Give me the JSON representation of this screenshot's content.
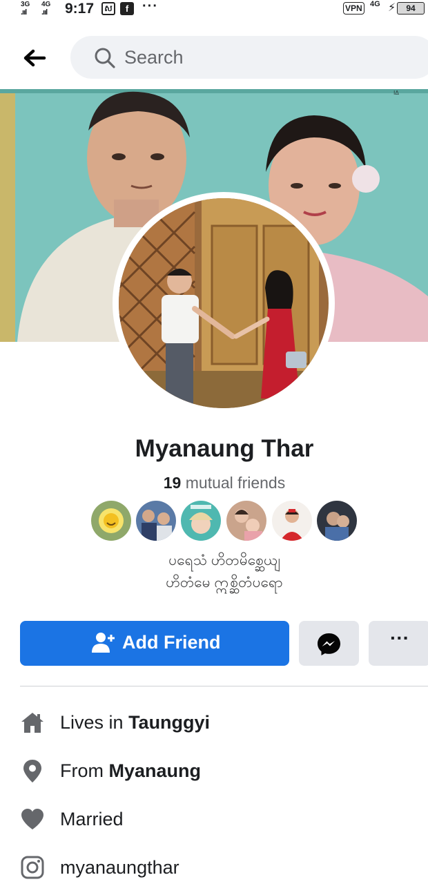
{
  "status_bar": {
    "signal1_label": "3G",
    "signal2_label": "4G",
    "time": "9:17",
    "notification_dots": "···",
    "vpn_label": "VPN",
    "network_label": "4G",
    "battery_level": "94"
  },
  "header": {
    "search_placeholder": "Search"
  },
  "profile": {
    "name": "Myanaung Thar",
    "mutual_count": "19",
    "mutual_label": " mutual friends",
    "bio_line1": "ပရေသံ ဟိတမိစ္ဆေယျ",
    "bio_line2": "ဟိတံမေ ဣစ္ဆိတံပရော"
  },
  "actions": {
    "add_friend_label": "Add Friend",
    "more_label": "···"
  },
  "details": {
    "lives_prefix": "Lives in ",
    "lives_value": "Taunggyi",
    "from_prefix": "From ",
    "from_value": "Myanaung",
    "relationship": "Married",
    "instagram": "myanaungthar"
  },
  "colors": {
    "primary_blue": "#1b74e4",
    "secondary_button_bg": "#e4e6eb",
    "search_bg": "#f0f2f5",
    "secondary_text": "#65676b",
    "icon_grey": "#65676b"
  },
  "icons": {
    "back": "arrow-left-icon",
    "search": "search-icon",
    "add_friend": "person-add-icon",
    "messenger": "messenger-icon",
    "home": "home-icon",
    "location": "location-pin-icon",
    "heart": "heart-icon",
    "instagram": "instagram-icon"
  }
}
